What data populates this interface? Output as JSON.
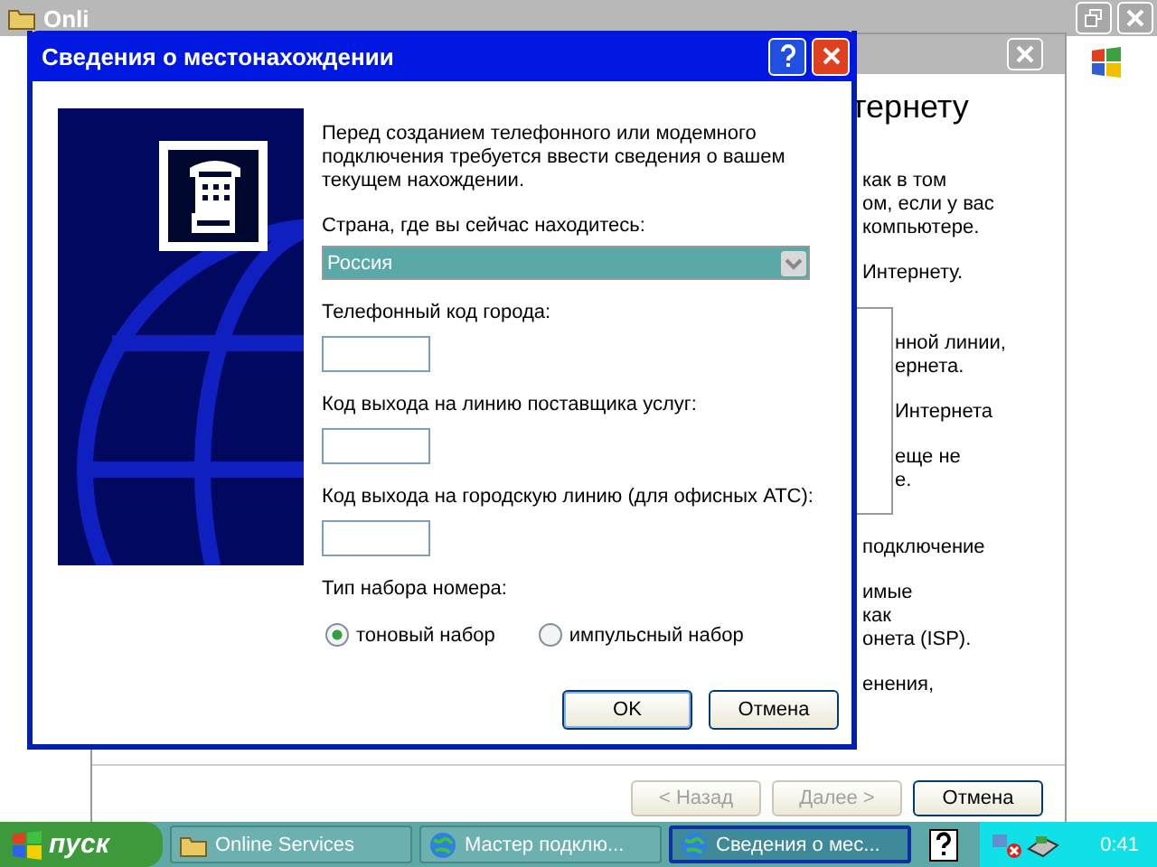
{
  "background_window": {
    "title": "Onli"
  },
  "wizard": {
    "heading": "тернету",
    "paragraphs": [
      [
        "как в том",
        "ом, если у вас",
        "компьютере."
      ],
      [
        "Интернету."
      ]
    ],
    "group_paragraphs": [
      [
        "нной линии,",
        "ернета."
      ],
      [
        "Интернета"
      ],
      [
        "еще не",
        "е."
      ]
    ],
    "after_paragraphs": [
      [
        "подключение"
      ],
      [
        "имые",
        "как",
        "онета (ISP)."
      ],
      [
        "енения,"
      ]
    ],
    "buttons": [
      {
        "label": "< Назад",
        "disabled": true
      },
      {
        "label": "Далее >",
        "disabled": true
      },
      {
        "label": "Отмена",
        "disabled": false
      }
    ]
  },
  "dialog": {
    "title": "Сведения о местонахождении",
    "intro": "Перед созданием телефонного или модемного подключения требуется ввести сведения о вашем текущем нахождении.",
    "country_label": "Страна, где вы сейчас находитесь:",
    "country_value": "Россия",
    "fields": [
      {
        "label": "Телефонный код города:"
      },
      {
        "label": "Код выхода на линию поставщика услуг:"
      },
      {
        "label": "Код выхода на городскую линию (для офисных АТС):"
      }
    ],
    "dial_type_label": "Тип набора номера:",
    "dial_options": [
      {
        "label": "тоновый набор",
        "selected": true
      },
      {
        "label": "импульсный набор",
        "selected": false
      }
    ],
    "buttons": [
      {
        "label": "OK",
        "default": true
      },
      {
        "label": "Отмена",
        "default": false
      }
    ]
  },
  "taskbar": {
    "start_label": "пуск",
    "tasks": [
      {
        "label": "Online Services",
        "kind": "folder",
        "selected": false
      },
      {
        "label": "Мастер подклю...",
        "kind": "wizard",
        "selected": false
      },
      {
        "label": "Сведения о мес...",
        "kind": "wizard",
        "selected": true
      }
    ],
    "clock": "0:41"
  }
}
